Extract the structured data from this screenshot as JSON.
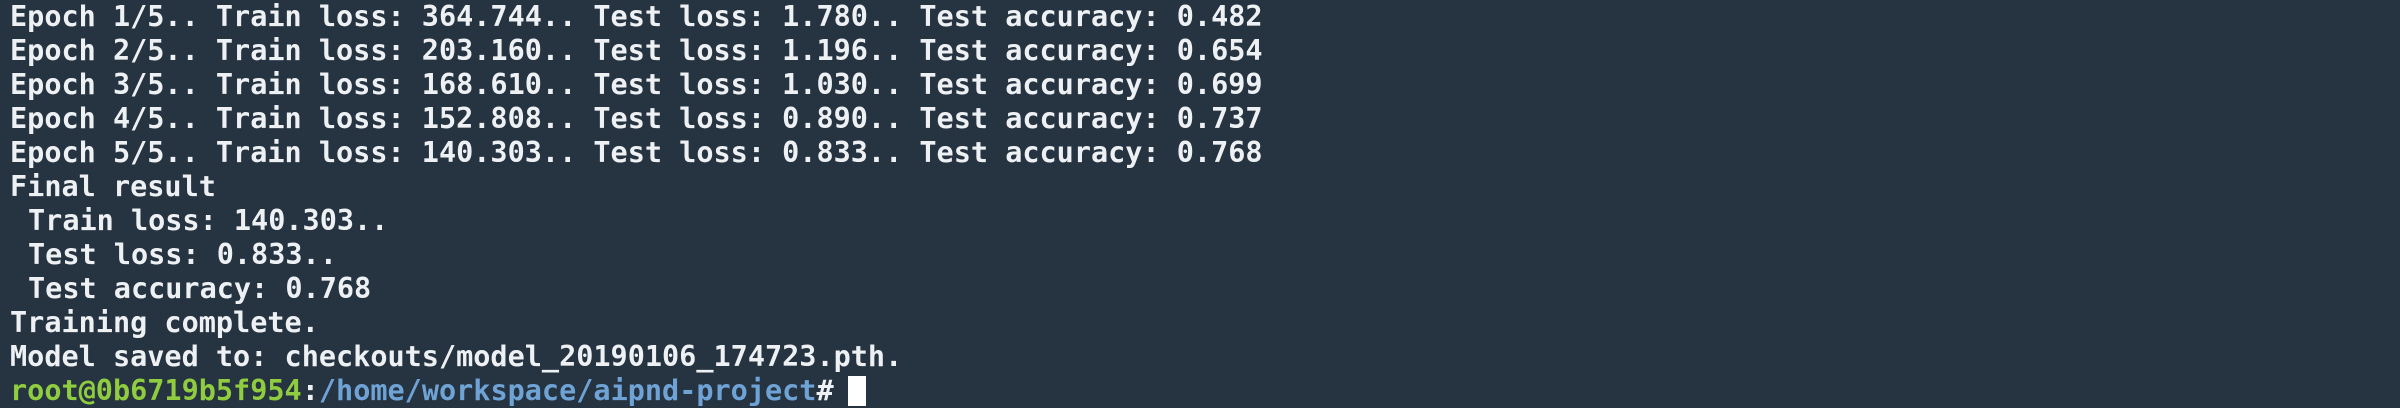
{
  "terminal": {
    "epochs": [
      "Epoch 1/5.. Train loss: 364.744.. Test loss: 1.780.. Test accuracy: 0.482",
      "Epoch 2/5.. Train loss: 203.160.. Test loss: 1.196.. Test accuracy: 0.654",
      "Epoch 3/5.. Train loss: 168.610.. Test loss: 1.030.. Test accuracy: 0.699",
      "Epoch 4/5.. Train loss: 152.808.. Test loss: 0.890.. Test accuracy: 0.737",
      "Epoch 5/5.. Train loss: 140.303.. Test loss: 0.833.. Test accuracy: 0.768"
    ],
    "final_header": "Final result",
    "final_train_loss": "Train loss: 140.303..",
    "final_test_loss": "Test loss: 0.833..",
    "final_test_accuracy": "Test accuracy: 0.768",
    "training_complete": "Training complete.",
    "model_saved": "Model saved to: checkouts/model_20190106_174723.pth.",
    "prompt": {
      "user_host": "root@0b6719b5f954",
      "separator": ":",
      "path": "/home/workspace/aipnd-project",
      "symbol": "#"
    }
  },
  "colors": {
    "background": "#263340",
    "text": "#eef1f4",
    "prompt_user": "#8fcc3f",
    "prompt_path": "#6fa3d6"
  }
}
